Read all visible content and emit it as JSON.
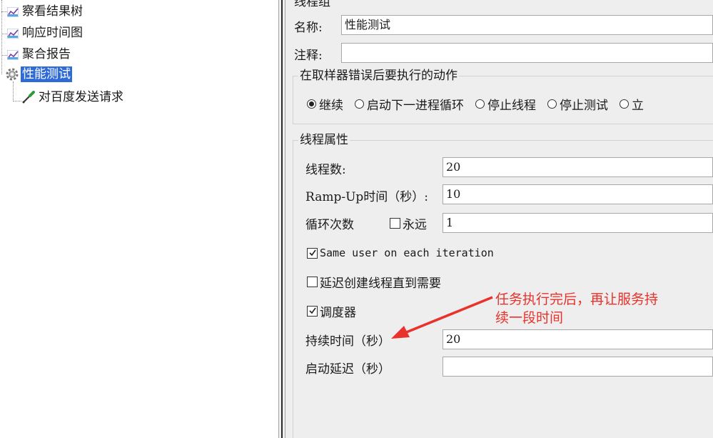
{
  "tree": {
    "items": [
      {
        "label": "察看结果树",
        "icon": "chart-icon"
      },
      {
        "label": "响应时间图",
        "icon": "chart-icon"
      },
      {
        "label": "聚合报告",
        "icon": "chart-icon"
      },
      {
        "label": "性能测试",
        "icon": "gear-icon",
        "selected": true
      },
      {
        "label": "对百度发送请求",
        "icon": "pipette-icon"
      }
    ]
  },
  "panel": {
    "title_cut": "线程组",
    "name_label": "名称:",
    "name_value": "性能测试",
    "comment_label": "注释:",
    "comment_value": "",
    "error_group": {
      "title": "在取样器错误后要执行的动作",
      "options": [
        "继续",
        "启动下一进程循环",
        "停止线程",
        "停止测试",
        "立"
      ],
      "selected": 0
    },
    "thread_group": {
      "title": "线程属性",
      "threads_label": "线程数:",
      "threads_value": "20",
      "rampup_label": "Ramp-Up时间（秒）:",
      "rampup_value": "10",
      "loop_label": "循环次数",
      "forever_label": "永远",
      "forever_checked": false,
      "loop_value": "1",
      "same_user_label": "Same user on each iteration",
      "same_user_checked": true,
      "delay_label": "延迟创建线程直到需要",
      "delay_checked": false,
      "scheduler_label": "调度器",
      "scheduler_checked": true,
      "duration_label": "持续时间（秒）",
      "duration_value": "20",
      "startup_delay_label": "启动延迟（秒）",
      "startup_delay_value": ""
    }
  },
  "annotation": {
    "line1": "任务执行完后，再让服务持",
    "line2": "续一段时间",
    "color": "#e8322b"
  }
}
